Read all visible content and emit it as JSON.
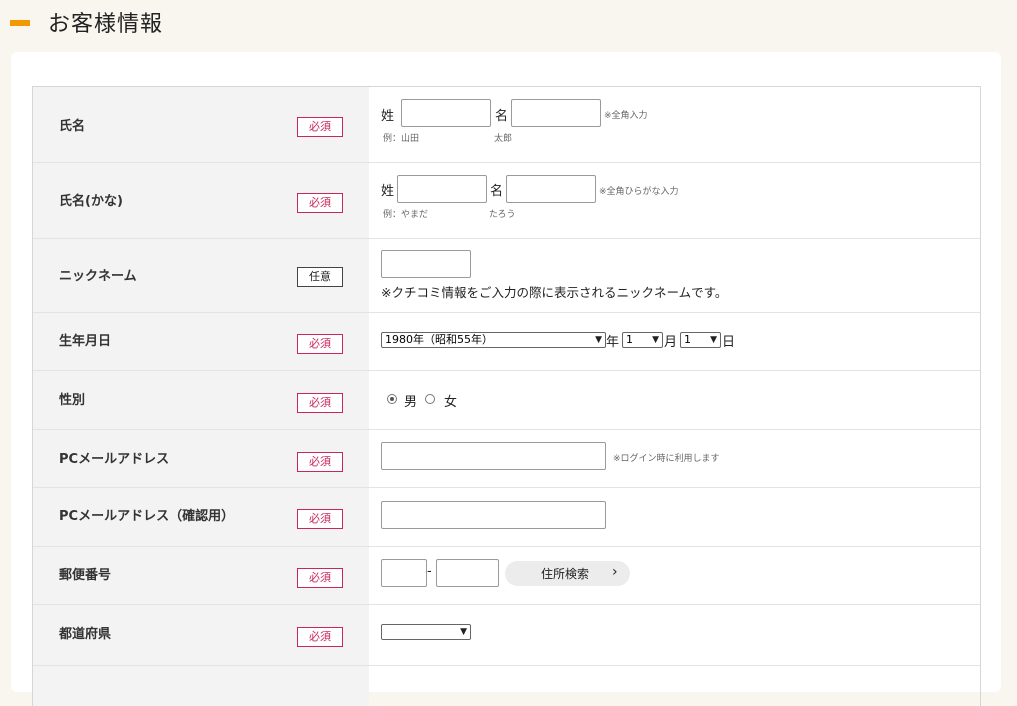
{
  "header": {
    "title": "お客様情報",
    "accent_color": "#f39800"
  },
  "badges": {
    "required": "必須",
    "optional": "任意"
  },
  "rows": {
    "name": {
      "label": "氏名",
      "sei": "姓",
      "mei": "名",
      "note": "※全角入力",
      "example_sei": "例：山田",
      "example_mei": "太郎"
    },
    "kana": {
      "label": "氏名(かな)",
      "sei": "姓",
      "mei": "名",
      "note": "※全角ひらがな入力",
      "example_sei": "例：やまだ",
      "example_mei": "たろう"
    },
    "nickname": {
      "label": "ニックネーム",
      "note": "※クチコミ情報をご入力の際に表示されるニックネームです。"
    },
    "birthday": {
      "label": "生年月日",
      "year_value": "1980年（昭和55年）",
      "year_suffix": "年",
      "month_value": "1",
      "month_suffix": "月",
      "day_value": "1",
      "day_suffix": "日"
    },
    "gender": {
      "label": "性別",
      "options": [
        "男",
        "女"
      ],
      "selected": "男"
    },
    "email": {
      "label": "PCメールアドレス",
      "note": "※ログイン時に利用します"
    },
    "email_confirm": {
      "label": "PCメールアドレス（確認用）"
    },
    "postal": {
      "label": "郵便番号",
      "separator": "-",
      "search_button": "住所検索"
    },
    "prefecture": {
      "label": "都道府県",
      "selected_value": ""
    }
  },
  "colors": {
    "required_badge": "#c8275a",
    "label_bg": "#f3f3f3",
    "page_bg": "#f8f6ef"
  },
  "icons": {
    "dropdown": "chevron-down-icon",
    "button_arrow": "chevron-right-icon"
  }
}
